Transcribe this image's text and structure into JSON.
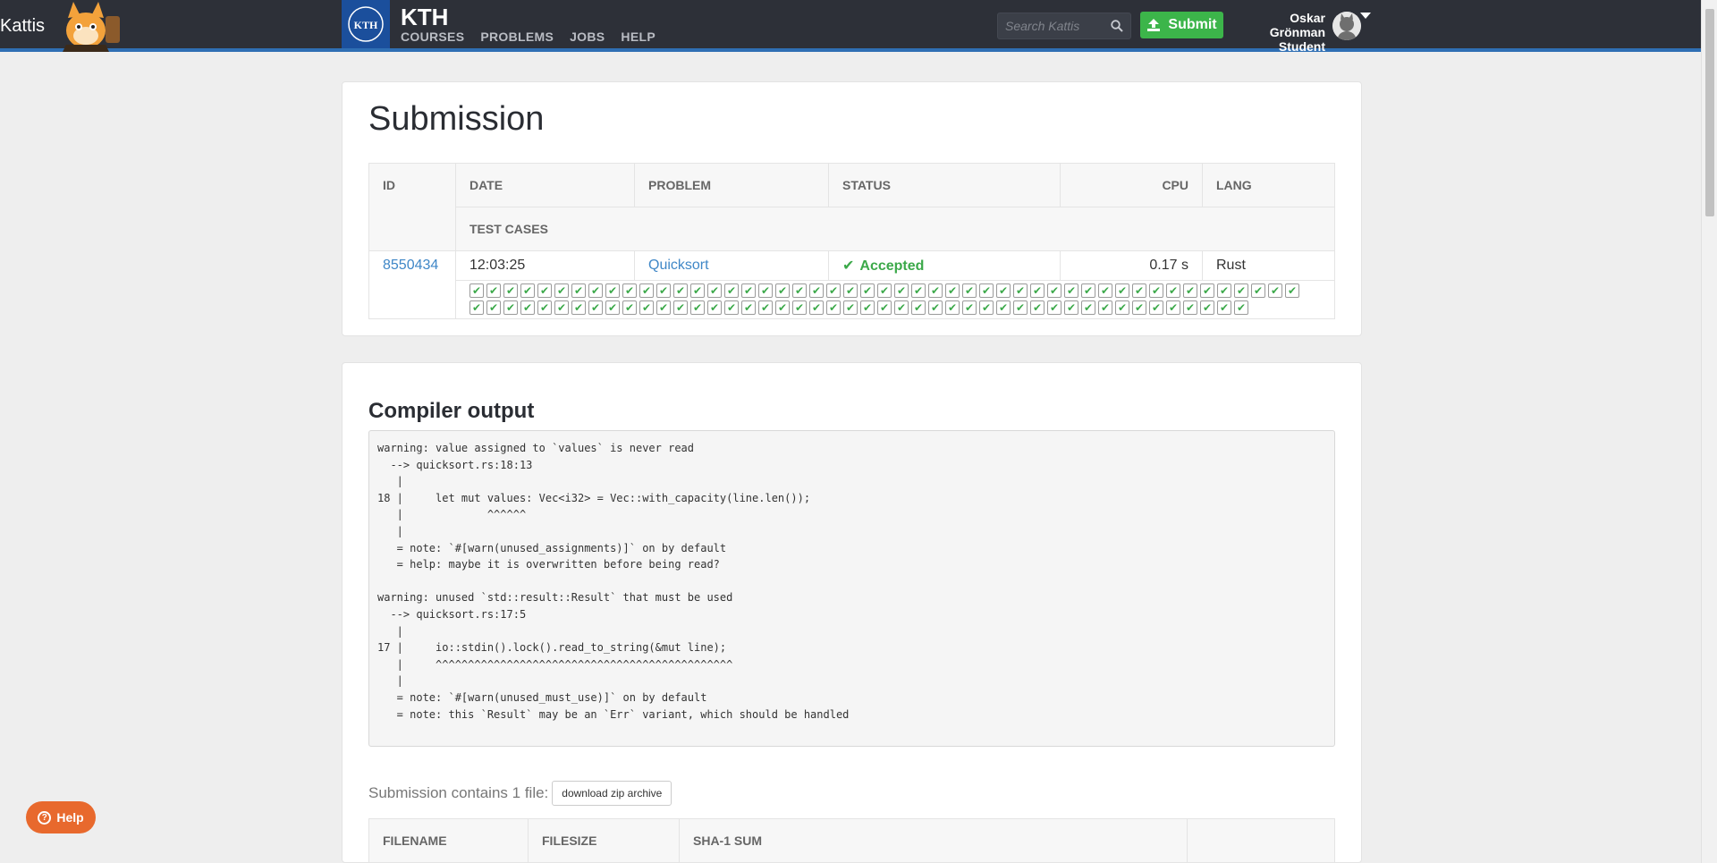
{
  "nav": {
    "brand_text": "Kattis",
    "kth_title": "KTH",
    "links": [
      "COURSES",
      "PROBLEMS",
      "JOBS",
      "HELP"
    ],
    "search_placeholder": "Search Kattis",
    "submit_label": "Submit",
    "user_name": "Oskar Grönman",
    "user_role": "Student"
  },
  "submission": {
    "title": "Submission",
    "headers": {
      "id": "ID",
      "date": "DATE",
      "problem": "PROBLEM",
      "status": "STATUS",
      "cpu": "CPU",
      "lang": "LANG",
      "test_cases": "TEST CASES"
    },
    "row": {
      "id": "8550434",
      "date": "12:03:25",
      "problem": "Quicksort",
      "status": "Accepted",
      "cpu": "0.17 s",
      "lang": "Rust"
    },
    "test_case_count": 95,
    "test_case_status": "accepted"
  },
  "compiler": {
    "title": "Compiler output",
    "output": "warning: value assigned to `values` is never read\n  --> quicksort.rs:18:13\n   |\n18 |     let mut values: Vec<i32> = Vec::with_capacity(line.len());\n   |             ^^^^^^\n   |\n   = note: `#[warn(unused_assignments)]` on by default\n   = help: maybe it is overwritten before being read?\n\nwarning: unused `std::result::Result` that must be used\n  --> quicksort.rs:17:5\n   |\n17 |     io::stdin().lock().read_to_string(&mut line);\n   |     ^^^^^^^^^^^^^^^^^^^^^^^^^^^^^^^^^^^^^^^^^^^^^^\n   |\n   = note: `#[warn(unused_must_use)]` on by default\n   = note: this `Result` may be an `Err` variant, which should be handled"
  },
  "files": {
    "summary": "Submission contains 1 file:",
    "download_label": "download zip archive",
    "headers": [
      "FILENAME",
      "FILESIZE",
      "SHA-1 SUM",
      ""
    ]
  },
  "help_button": "Help",
  "colors": {
    "nav_bg": "#2d3038",
    "nav_accent": "#2f6fb4",
    "accepted": "#3ca94a",
    "link": "#3f87c7",
    "help": "#e8692d"
  }
}
